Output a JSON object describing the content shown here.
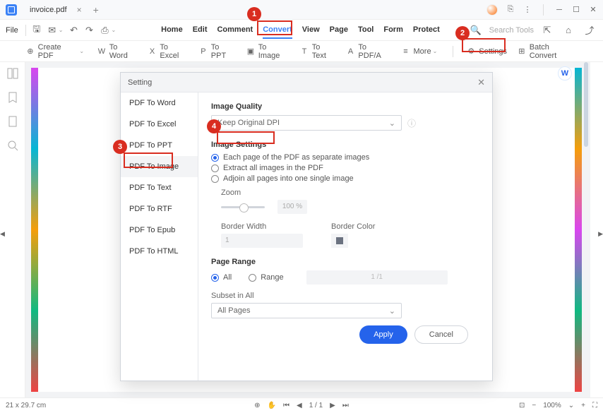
{
  "titlebar": {
    "filename": "invoice.pdf"
  },
  "menu": {
    "file": "File",
    "tabs": [
      "Home",
      "Edit",
      "Comment",
      "Convert",
      "View",
      "Page",
      "Tool",
      "Form",
      "Protect"
    ],
    "active_tab": "Convert",
    "search_placeholder": "Search Tools"
  },
  "toolbar": {
    "create_pdf": "Create PDF",
    "to_word": "To Word",
    "to_excel": "To Excel",
    "to_ppt": "To PPT",
    "to_image": "To Image",
    "to_text": "To Text",
    "to_pdfa": "To PDF/A",
    "more": "More",
    "settings": "Settings",
    "batch": "Batch Convert"
  },
  "dialog": {
    "title": "Setting",
    "sidebar": [
      "PDF To Word",
      "PDF To Excel",
      "PDF To PPT",
      "PDF To Image",
      "PDF To Text",
      "PDF To RTF",
      "PDF To Epub",
      "PDF To HTML"
    ],
    "active_side": "PDF To Image",
    "image_quality": {
      "label": "Image Quality",
      "value": "Keep Original DPI"
    },
    "image_settings": {
      "label": "Image Settings",
      "opt1": "Each page of the PDF as separate images",
      "opt2": "Extract all images in the PDF",
      "opt3": "Adjoin all pages into one single image",
      "zoom_label": "Zoom",
      "zoom_val": "100 %",
      "border_width_label": "Border Width",
      "border_width_val": "1",
      "border_color_label": "Border Color"
    },
    "page_range": {
      "label": "Page Range",
      "all": "All",
      "range": "Range",
      "range_val": "1 /1",
      "subset_label": "Subset in All",
      "subset_val": "All Pages"
    },
    "apply": "Apply",
    "cancel": "Cancel"
  },
  "statusbar": {
    "dims": "21 x 29.7 cm",
    "page": "1 / 1",
    "zoom": "100%"
  },
  "markers": {
    "m1": "1",
    "m2": "2",
    "m3": "3",
    "m4": "4"
  }
}
